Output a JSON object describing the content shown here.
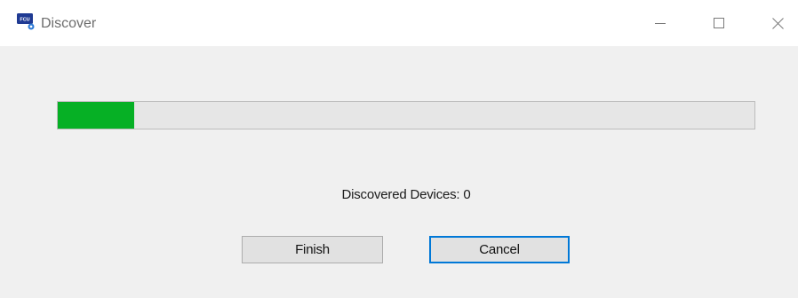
{
  "window": {
    "title": "Discover",
    "app_icon_text": "FCU",
    "controls": {
      "minimize_icon": "minimize-icon",
      "maximize_icon": "maximize-icon",
      "close_icon": "close-icon"
    }
  },
  "progress": {
    "fraction": 0.11,
    "fill_color": "#06b025"
  },
  "status": {
    "text": "Discovered Devices: 0"
  },
  "buttons": {
    "finish_label": "Finish",
    "cancel_label": "Cancel"
  },
  "colors": {
    "accent": "#0078d7",
    "progress": "#06b025"
  }
}
